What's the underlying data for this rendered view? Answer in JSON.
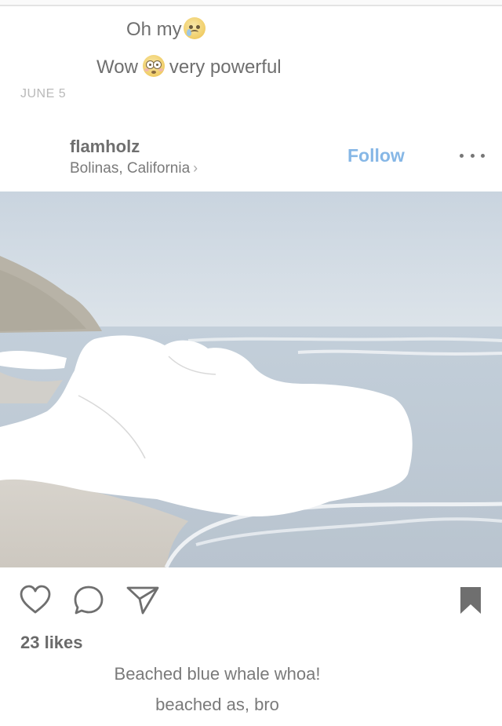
{
  "comments": [
    {
      "text": "Oh my",
      "emoji": "crying-face"
    },
    {
      "text_before": "Wow",
      "emoji": "flushed-face",
      "text_after": "very powerful"
    }
  ],
  "date": "JUNE 5",
  "post": {
    "username": "flamholz",
    "location": "Bolinas, California",
    "follow_label": "Follow",
    "more_icon": "more-horizontal-icon",
    "likes": "23 likes",
    "caption_lines": [
      "Beached blue whale whoa!",
      "beached as, bro"
    ]
  },
  "colors": {
    "follow": "#86b7e6",
    "text": "#777777"
  }
}
